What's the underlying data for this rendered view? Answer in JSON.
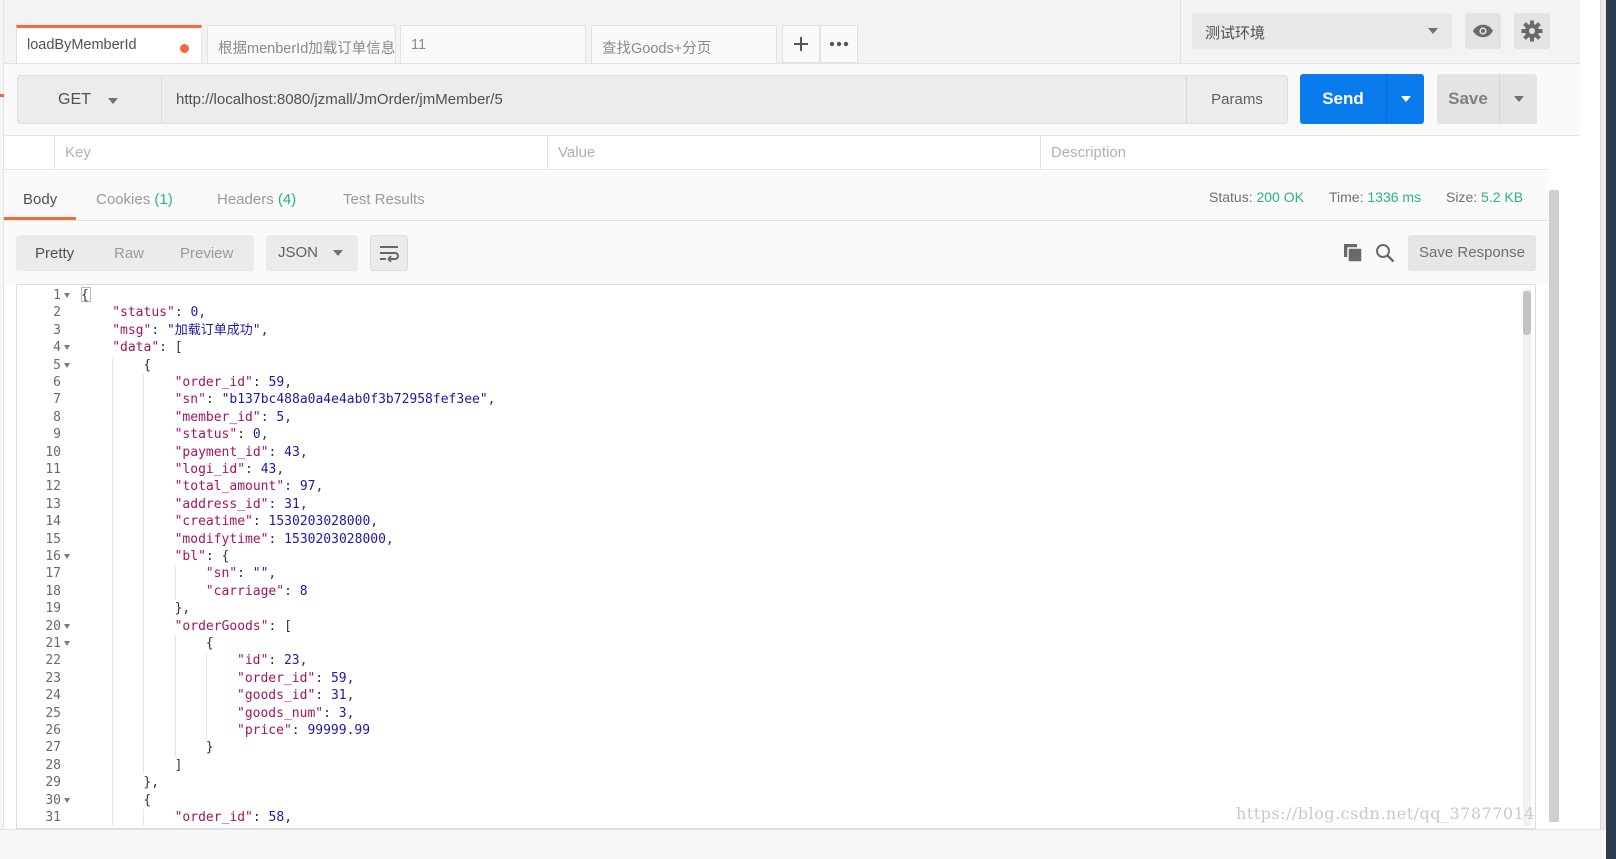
{
  "tabs": [
    {
      "label": "loadByMemberId",
      "active": true,
      "unsaved": true
    },
    {
      "label": "根据menberId加载订单信息",
      "active": false
    },
    {
      "label": "11",
      "active": false
    },
    {
      "label": "查找Goods+分页",
      "active": false
    }
  ],
  "environment": {
    "selected": "测试环境"
  },
  "request": {
    "method": "GET",
    "url": "http://localhost:8080/jzmall/JmOrder/jmMember/5",
    "params_label": "Params",
    "send_label": "Send",
    "save_label": "Save"
  },
  "params_table": {
    "columns": [
      "Key",
      "Value",
      "Description"
    ]
  },
  "response_tabs": {
    "body": "Body",
    "cookies": "Cookies",
    "cookies_count": "(1)",
    "headers": "Headers",
    "headers_count": "(4)",
    "test_results": "Test Results"
  },
  "status": {
    "status_label": "Status:",
    "status_value": "200 OK",
    "time_label": "Time:",
    "time_value": "1336 ms",
    "size_label": "Size:",
    "size_value": "5.2 KB"
  },
  "body_toolbar": {
    "pretty": "Pretty",
    "raw": "Raw",
    "preview": "Preview",
    "format": "JSON",
    "save_response": "Save Response"
  },
  "code_lines": [
    {
      "n": "1",
      "fold": true,
      "indent": 0,
      "parts": [
        [
          "p",
          "{"
        ]
      ]
    },
    {
      "n": "2",
      "indent": 1,
      "parts": [
        [
          "k",
          "\"status\""
        ],
        [
          "p",
          ": "
        ],
        [
          "n",
          "0"
        ],
        [
          "p",
          ","
        ]
      ]
    },
    {
      "n": "3",
      "indent": 1,
      "parts": [
        [
          "k",
          "\"msg\""
        ],
        [
          "p",
          ": "
        ],
        [
          "s",
          "\"加载订单成功\""
        ],
        [
          "p",
          ","
        ]
      ]
    },
    {
      "n": "4",
      "fold": true,
      "indent": 1,
      "parts": [
        [
          "k",
          "\"data\""
        ],
        [
          "p",
          ": ["
        ]
      ]
    },
    {
      "n": "5",
      "fold": true,
      "indent": 2,
      "parts": [
        [
          "p",
          "{"
        ]
      ]
    },
    {
      "n": "6",
      "indent": 3,
      "parts": [
        [
          "k",
          "\"order_id\""
        ],
        [
          "p",
          ": "
        ],
        [
          "n",
          "59"
        ],
        [
          "p",
          ","
        ]
      ]
    },
    {
      "n": "7",
      "indent": 3,
      "parts": [
        [
          "k",
          "\"sn\""
        ],
        [
          "p",
          ": "
        ],
        [
          "s",
          "\"b137bc488a0a4e4ab0f3b72958fef3ee\""
        ],
        [
          "p",
          ","
        ]
      ]
    },
    {
      "n": "8",
      "indent": 3,
      "parts": [
        [
          "k",
          "\"member_id\""
        ],
        [
          "p",
          ": "
        ],
        [
          "n",
          "5"
        ],
        [
          "p",
          ","
        ]
      ]
    },
    {
      "n": "9",
      "indent": 3,
      "parts": [
        [
          "k",
          "\"status\""
        ],
        [
          "p",
          ": "
        ],
        [
          "n",
          "0"
        ],
        [
          "p",
          ","
        ]
      ]
    },
    {
      "n": "10",
      "indent": 3,
      "parts": [
        [
          "k",
          "\"payment_id\""
        ],
        [
          "p",
          ": "
        ],
        [
          "n",
          "43"
        ],
        [
          "p",
          ","
        ]
      ]
    },
    {
      "n": "11",
      "indent": 3,
      "parts": [
        [
          "k",
          "\"logi_id\""
        ],
        [
          "p",
          ": "
        ],
        [
          "n",
          "43"
        ],
        [
          "p",
          ","
        ]
      ]
    },
    {
      "n": "12",
      "indent": 3,
      "parts": [
        [
          "k",
          "\"total_amount\""
        ],
        [
          "p",
          ": "
        ],
        [
          "n",
          "97"
        ],
        [
          "p",
          ","
        ]
      ]
    },
    {
      "n": "13",
      "indent": 3,
      "parts": [
        [
          "k",
          "\"address_id\""
        ],
        [
          "p",
          ": "
        ],
        [
          "n",
          "31"
        ],
        [
          "p",
          ","
        ]
      ]
    },
    {
      "n": "14",
      "indent": 3,
      "parts": [
        [
          "k",
          "\"creatime\""
        ],
        [
          "p",
          ": "
        ],
        [
          "n",
          "1530203028000"
        ],
        [
          "p",
          ","
        ]
      ]
    },
    {
      "n": "15",
      "indent": 3,
      "parts": [
        [
          "k",
          "\"modifytime\""
        ],
        [
          "p",
          ": "
        ],
        [
          "n",
          "1530203028000"
        ],
        [
          "p",
          ","
        ]
      ]
    },
    {
      "n": "16",
      "fold": true,
      "indent": 3,
      "parts": [
        [
          "k",
          "\"bl\""
        ],
        [
          "p",
          ": {"
        ]
      ]
    },
    {
      "n": "17",
      "indent": 4,
      "parts": [
        [
          "k",
          "\"sn\""
        ],
        [
          "p",
          ": "
        ],
        [
          "s",
          "\"\""
        ],
        [
          "p",
          ","
        ]
      ]
    },
    {
      "n": "18",
      "indent": 4,
      "parts": [
        [
          "k",
          "\"carriage\""
        ],
        [
          "p",
          ": "
        ],
        [
          "n",
          "8"
        ]
      ]
    },
    {
      "n": "19",
      "indent": 3,
      "parts": [
        [
          "p",
          "},"
        ]
      ]
    },
    {
      "n": "20",
      "fold": true,
      "indent": 3,
      "parts": [
        [
          "k",
          "\"orderGoods\""
        ],
        [
          "p",
          ": ["
        ]
      ]
    },
    {
      "n": "21",
      "fold": true,
      "indent": 4,
      "parts": [
        [
          "p",
          "{"
        ]
      ]
    },
    {
      "n": "22",
      "indent": 5,
      "parts": [
        [
          "k",
          "\"id\""
        ],
        [
          "p",
          ": "
        ],
        [
          "n",
          "23"
        ],
        [
          "p",
          ","
        ]
      ]
    },
    {
      "n": "23",
      "indent": 5,
      "parts": [
        [
          "k",
          "\"order_id\""
        ],
        [
          "p",
          ": "
        ],
        [
          "n",
          "59"
        ],
        [
          "p",
          ","
        ]
      ]
    },
    {
      "n": "24",
      "indent": 5,
      "parts": [
        [
          "k",
          "\"goods_id\""
        ],
        [
          "p",
          ": "
        ],
        [
          "n",
          "31"
        ],
        [
          "p",
          ","
        ]
      ]
    },
    {
      "n": "25",
      "indent": 5,
      "parts": [
        [
          "k",
          "\"goods_num\""
        ],
        [
          "p",
          ": "
        ],
        [
          "n",
          "3"
        ],
        [
          "p",
          ","
        ]
      ]
    },
    {
      "n": "26",
      "indent": 5,
      "parts": [
        [
          "k",
          "\"price\""
        ],
        [
          "p",
          ": "
        ],
        [
          "n",
          "99999.99"
        ]
      ]
    },
    {
      "n": "27",
      "indent": 4,
      "parts": [
        [
          "p",
          "}"
        ]
      ]
    },
    {
      "n": "28",
      "indent": 3,
      "parts": [
        [
          "p",
          "]"
        ]
      ]
    },
    {
      "n": "29",
      "indent": 2,
      "parts": [
        [
          "p",
          "},"
        ]
      ]
    },
    {
      "n": "30",
      "fold": true,
      "indent": 2,
      "parts": [
        [
          "p",
          "{"
        ]
      ]
    },
    {
      "n": "31",
      "indent": 3,
      "parts": [
        [
          "k",
          "\"order_id\""
        ],
        [
          "p",
          ": "
        ],
        [
          "n",
          "58"
        ],
        [
          "p",
          ","
        ]
      ]
    }
  ],
  "watermark": "https://blog.csdn.net/qq_37877014",
  "colors": {
    "accent": "#f26b3a",
    "send": "#097bed",
    "success": "#26b47f",
    "json_key": "#a11561",
    "json_value": "#1a1aa6"
  },
  "icons": [
    "plus-icon",
    "more-icon",
    "eye-icon",
    "gear-icon",
    "wrap-lines-icon",
    "copy-icon",
    "search-icon"
  ]
}
